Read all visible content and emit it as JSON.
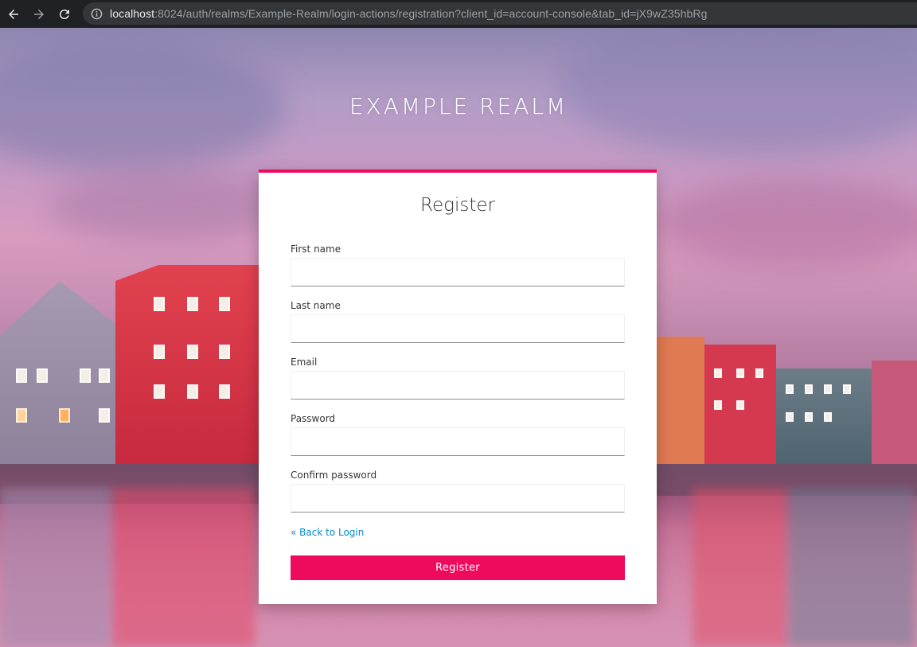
{
  "browser": {
    "url_host": "localhost",
    "url_rest": ":8024/auth/realms/Example-Realm/login-actions/registration?client_id=account-console&tab_id=jX9wZ35hbRg",
    "icons": {
      "back": "arrow-left-icon",
      "forward": "arrow-right-icon",
      "reload": "reload-icon",
      "info": "info-icon"
    }
  },
  "realm": {
    "title": "EXAMPLE REALM"
  },
  "form": {
    "title": "Register",
    "fields": [
      {
        "label": "First name",
        "value": ""
      },
      {
        "label": "Last name",
        "value": ""
      },
      {
        "label": "Email",
        "value": ""
      },
      {
        "label": "Password",
        "value": ""
      },
      {
        "label": "Confirm password",
        "value": ""
      }
    ],
    "back_link": "« Back to Login",
    "submit_label": "Register"
  },
  "colors": {
    "accent": "#ee0a5c",
    "link": "#0088ce",
    "chrome_bg": "#202124",
    "urlbar_bg": "#35363a"
  }
}
